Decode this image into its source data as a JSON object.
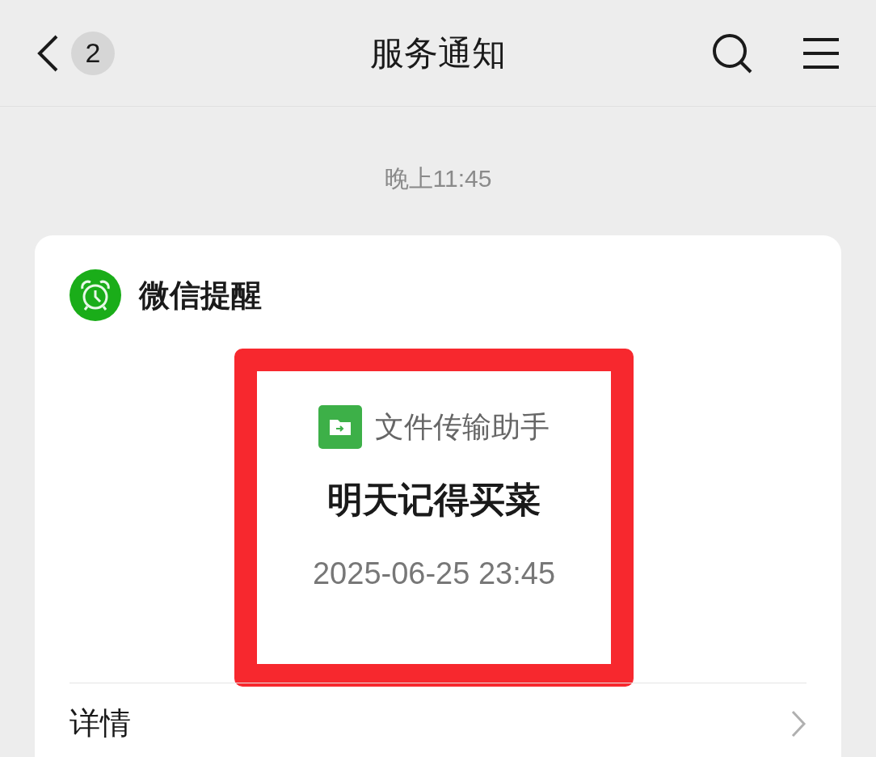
{
  "header": {
    "unread_count": "2",
    "title": "服务通知"
  },
  "timestamp": "晚上11:45",
  "card": {
    "app_name": "微信提醒",
    "highlighted": true,
    "source": "文件传输助手",
    "message": "明天记得买菜",
    "time": "2025-06-25 23:45",
    "details_label": "详情"
  }
}
